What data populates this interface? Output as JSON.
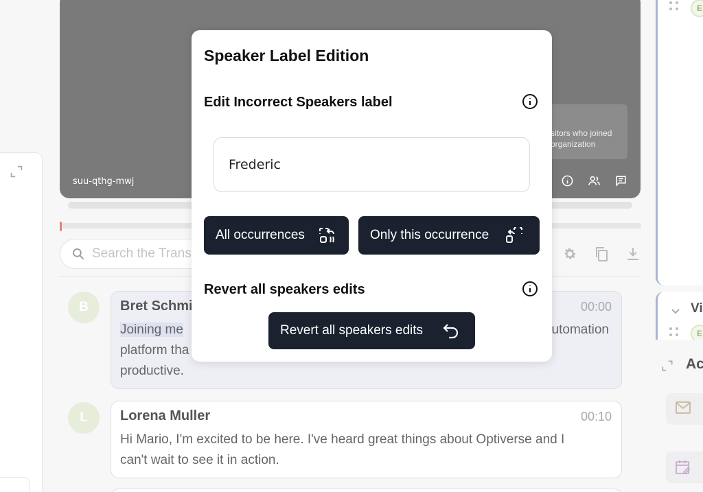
{
  "video": {
    "room_code": "suu-qthg-mwj",
    "visitors_line1": "sitors who joined",
    "visitors_line2": "organization"
  },
  "search": {
    "placeholder": "Search the Transcript"
  },
  "messages": [
    {
      "avatar": "B",
      "name": "Bret Schmi",
      "time": "00:00",
      "highlight": "Joining me",
      "line1_end": "utomation",
      "line2": "platform tha",
      "line3": "productive."
    },
    {
      "avatar": "L",
      "name": "Lorena Muller",
      "time": "00:10",
      "line1": "Hi Mario, I'm excited to be here. I've heard great things about Optiverse and I",
      "line2": "can't wait to see it in action."
    }
  ],
  "right_panel": {
    "section_vi": "Vi",
    "section_ac": "Ac",
    "badge_letter": "E"
  },
  "modal": {
    "title": "Speaker Label Edition",
    "edit_section": "Edit Incorrect Speakers label",
    "speaker_value": "Frederic",
    "all_occurrences": "All occurrences",
    "only_this_occurrence": "Only this occurrence",
    "revert_section": "Revert all speakers edits",
    "revert_button": "Revert all speakers edits"
  }
}
